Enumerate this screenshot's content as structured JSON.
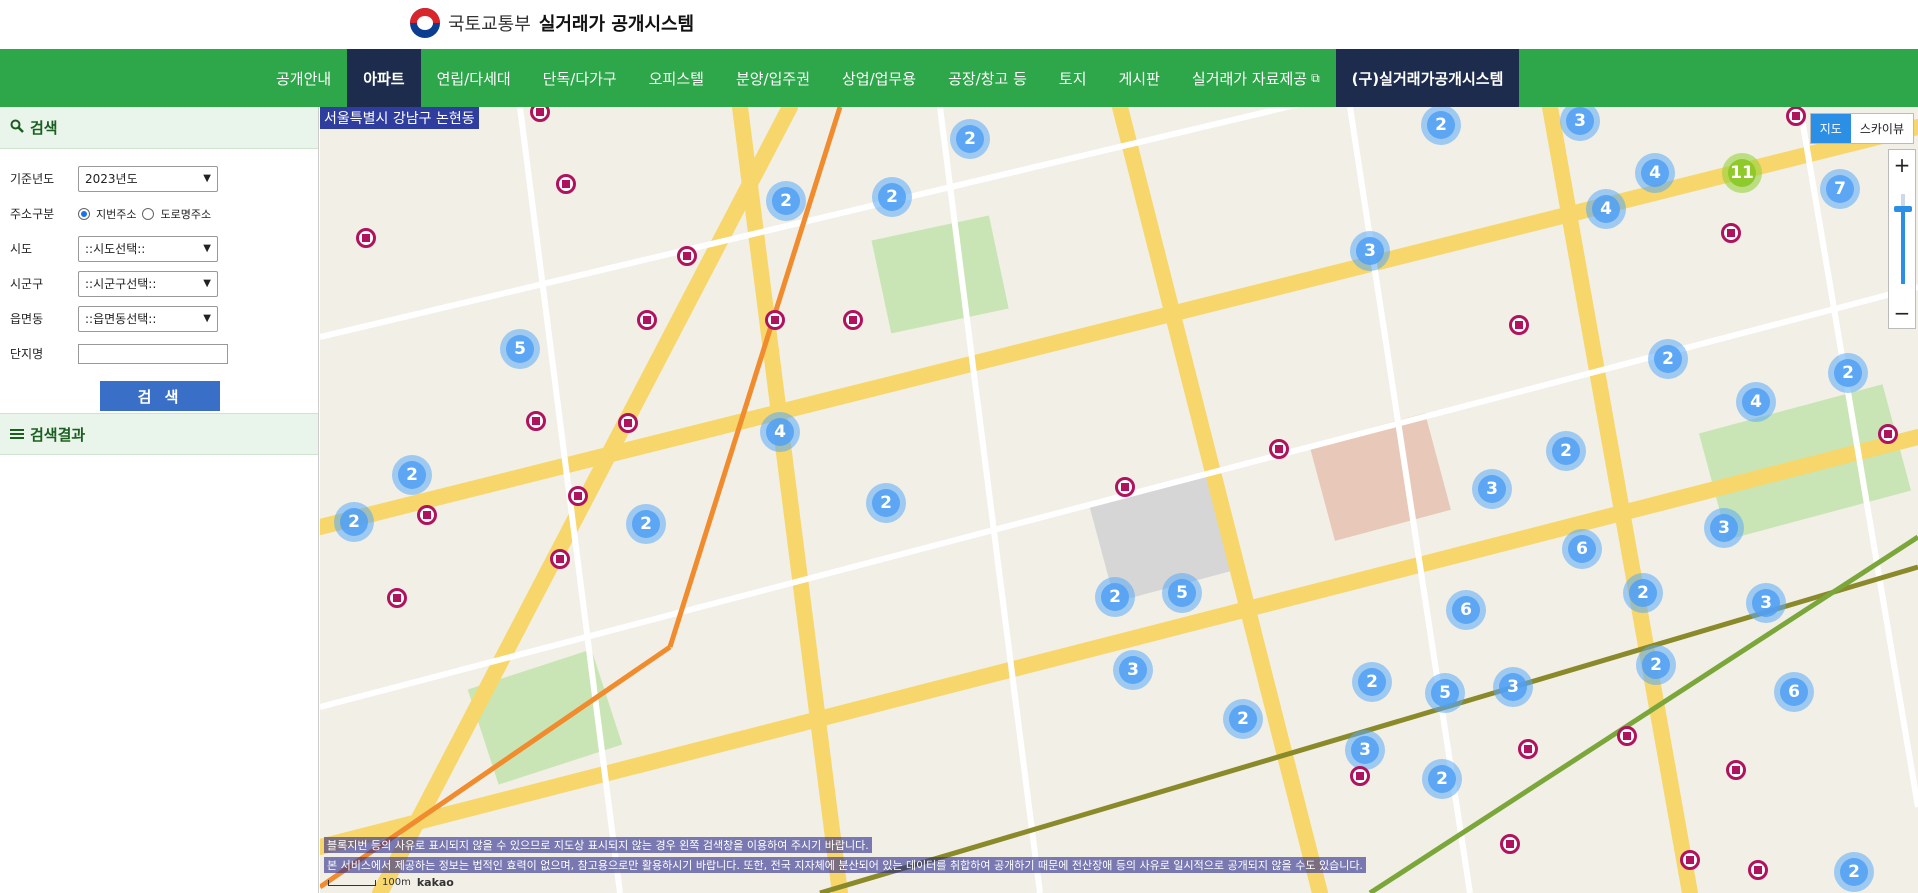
{
  "header": {
    "org": "국토교통부",
    "system": "실거래가 공개시스템"
  },
  "nav": [
    {
      "label": "공개안내"
    },
    {
      "label": "아파트"
    },
    {
      "label": "연립/다세대"
    },
    {
      "label": "단독/다가구"
    },
    {
      "label": "오피스텔"
    },
    {
      "label": "분양/입주권"
    },
    {
      "label": "상업/업무용"
    },
    {
      "label": "공장/창고 등"
    },
    {
      "label": "토지"
    },
    {
      "label": "게시판"
    },
    {
      "label": "실거래가 자료제공"
    },
    {
      "label": "(구)실거래가공개시스템"
    }
  ],
  "sidebar": {
    "search_title": "검색",
    "year_label": "기준년도",
    "year_value": "2023년도",
    "addr_label": "주소구분",
    "addr_opt1": "지번주소",
    "addr_opt2": "도로명주소",
    "sido_label": "시도",
    "sido_value": "::시도선택::",
    "sigungu_label": "시군구",
    "sigungu_value": "::시군구선택::",
    "dong_label": "읍면동",
    "dong_value": "::읍면동선택::",
    "complex_label": "단지명",
    "search_button": "검 색",
    "results_title": "검색결과"
  },
  "map": {
    "location": "서울특별시 강남구 논현동",
    "view_map": "지도",
    "view_sky": "스카이뷰",
    "zoom_in": "+",
    "zoom_out": "−",
    "notice1": "블록지번 등의 사유로 표시되지 않을 수 있으므로 지도상 표시되지 않는 경우 왼쪽 검색창을 이용하여 주시기 바랍니다.",
    "notice2": "본 서비스에서 제공하는 정보는 법적인 효력이 없으며, 참고용으로만 활용하시기 바랍니다. 또한, 전국 지자체에 분산되어 있는 데이터를 취합하여 공개하기 때문에 전산장애 등의 사유로 일시적으로 공개되지 않을 수도 있습니다.",
    "scale": "100m",
    "brand": "kakao",
    "clusters": [
      "5",
      "2",
      "2",
      "2",
      "2",
      "4",
      "2",
      "2",
      "2",
      "2",
      "5",
      "3",
      "2",
      "2",
      "2",
      "3",
      "3",
      "4",
      "11",
      "7",
      "4",
      "2",
      "2",
      "4",
      "3",
      "2",
      "3",
      "6",
      "6",
      "3",
      "2",
      "3",
      "5",
      "2",
      "3",
      "2",
      "6",
      "2"
    ]
  },
  "colors": {
    "nav": "#2ea64a",
    "active": "#1d2c4d",
    "cluster": "#5aaafa",
    "pin": "#b0135e"
  }
}
